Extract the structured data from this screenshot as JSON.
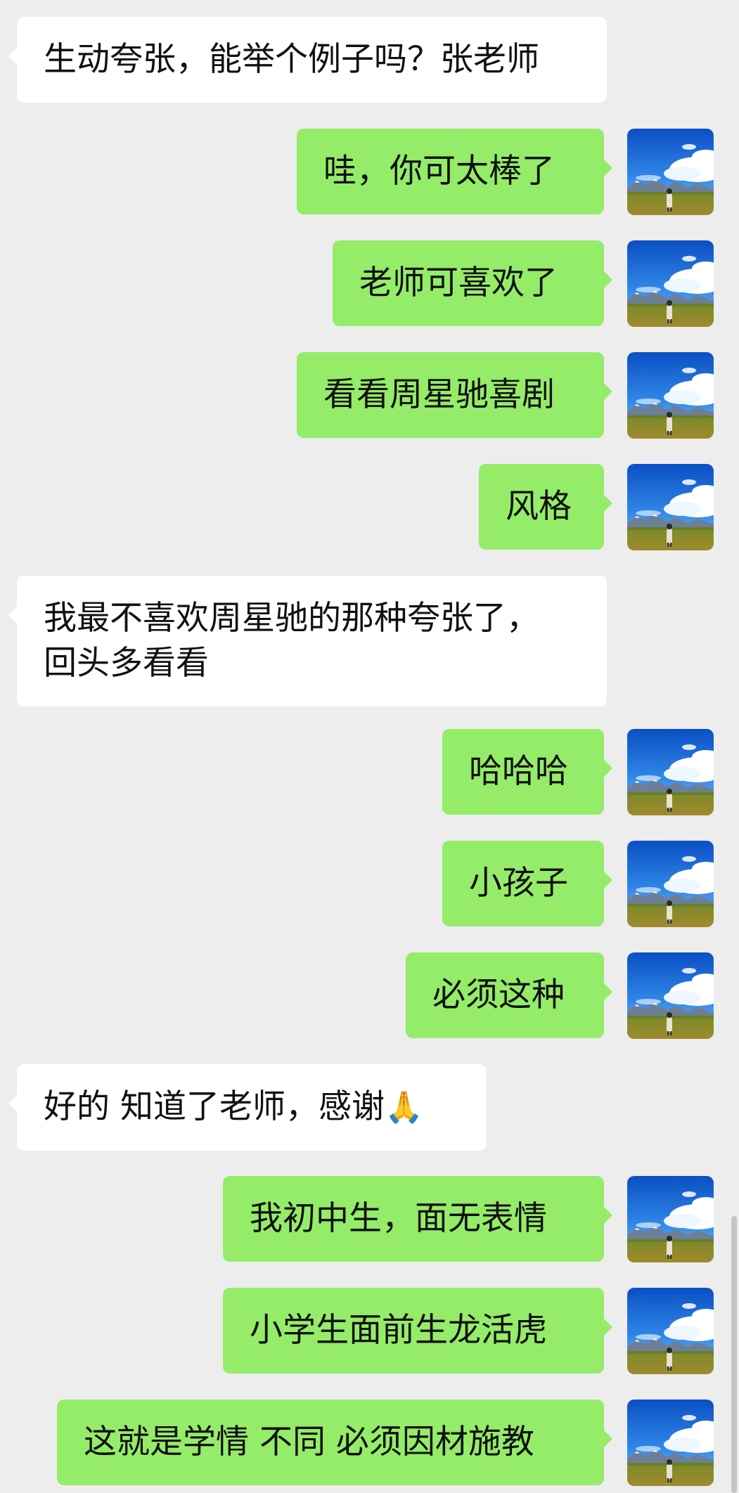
{
  "messages": [
    {
      "side": "in",
      "text": "生动夸张，能举个例子吗？张老师"
    },
    {
      "side": "out",
      "text": "哇，你可太棒了"
    },
    {
      "side": "out",
      "text": "老师可喜欢了"
    },
    {
      "side": "out",
      "text": "看看周星驰喜剧"
    },
    {
      "side": "out",
      "text": "风格"
    },
    {
      "side": "in",
      "lines": [
        "我最不喜欢周星驰的那种夸张了，",
        "回头多看看"
      ]
    },
    {
      "side": "out",
      "text": "哈哈哈"
    },
    {
      "side": "out",
      "text": "小孩子"
    },
    {
      "side": "out",
      "text": "必须这种"
    },
    {
      "side": "in",
      "text": "好的 知道了老师，感谢",
      "emoji": "🙏"
    },
    {
      "side": "out",
      "text": "我初中生，面无表情"
    },
    {
      "side": "out",
      "text": "小学生面前生龙活虎"
    },
    {
      "side": "out",
      "text": "这就是学情 不同 必须因材施教"
    }
  ],
  "avatar_icon": "landscape-avatar-icon",
  "colors": {
    "background": "#ededed",
    "incoming_bubble": "#ffffff",
    "outgoing_bubble": "#95ec69",
    "text": "#111111"
  }
}
